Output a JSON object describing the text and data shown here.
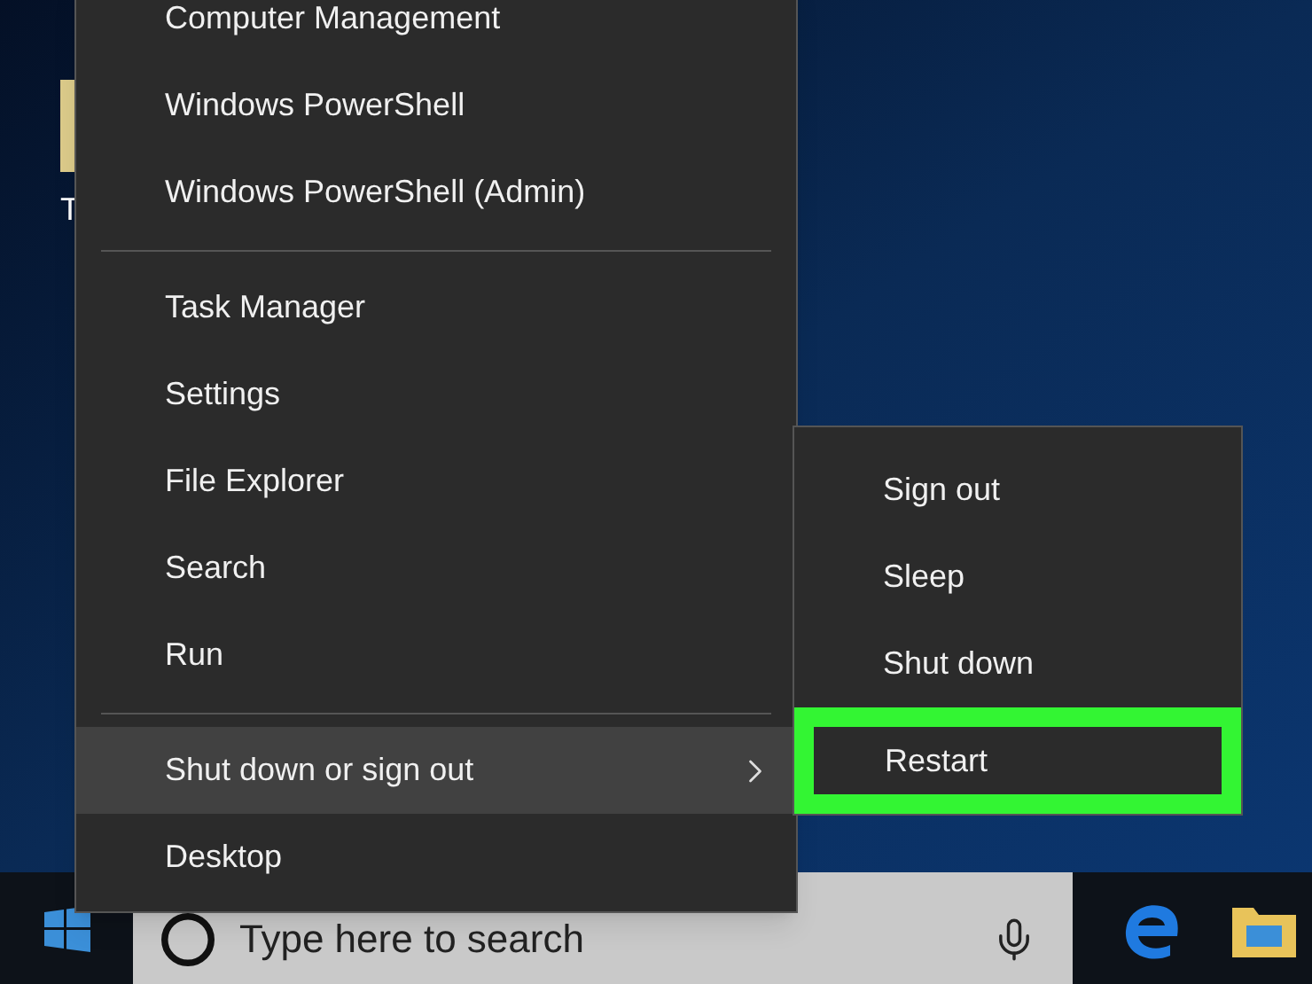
{
  "desktop": {
    "icon_label": "T"
  },
  "context_menu": {
    "groups": [
      {
        "items": [
          {
            "label": "Computer Management",
            "selected": false
          },
          {
            "label": "Windows PowerShell",
            "selected": false
          },
          {
            "label": "Windows PowerShell (Admin)",
            "selected": false
          }
        ]
      },
      {
        "items": [
          {
            "label": "Task Manager",
            "selected": false
          },
          {
            "label": "Settings",
            "selected": false
          },
          {
            "label": "File Explorer",
            "selected": false
          },
          {
            "label": "Search",
            "selected": false
          },
          {
            "label": "Run",
            "selected": false
          }
        ]
      },
      {
        "items": [
          {
            "label": "Shut down or sign out",
            "selected": true,
            "has_submenu": true
          },
          {
            "label": "Desktop",
            "selected": false
          }
        ]
      }
    ]
  },
  "submenu": {
    "items": [
      {
        "label": "Sign out",
        "highlighted": false
      },
      {
        "label": "Sleep",
        "highlighted": false
      },
      {
        "label": "Shut down",
        "highlighted": false
      },
      {
        "label": "Restart",
        "highlighted": true
      }
    ]
  },
  "taskbar": {
    "search": {
      "placeholder": "Type here to search"
    }
  }
}
